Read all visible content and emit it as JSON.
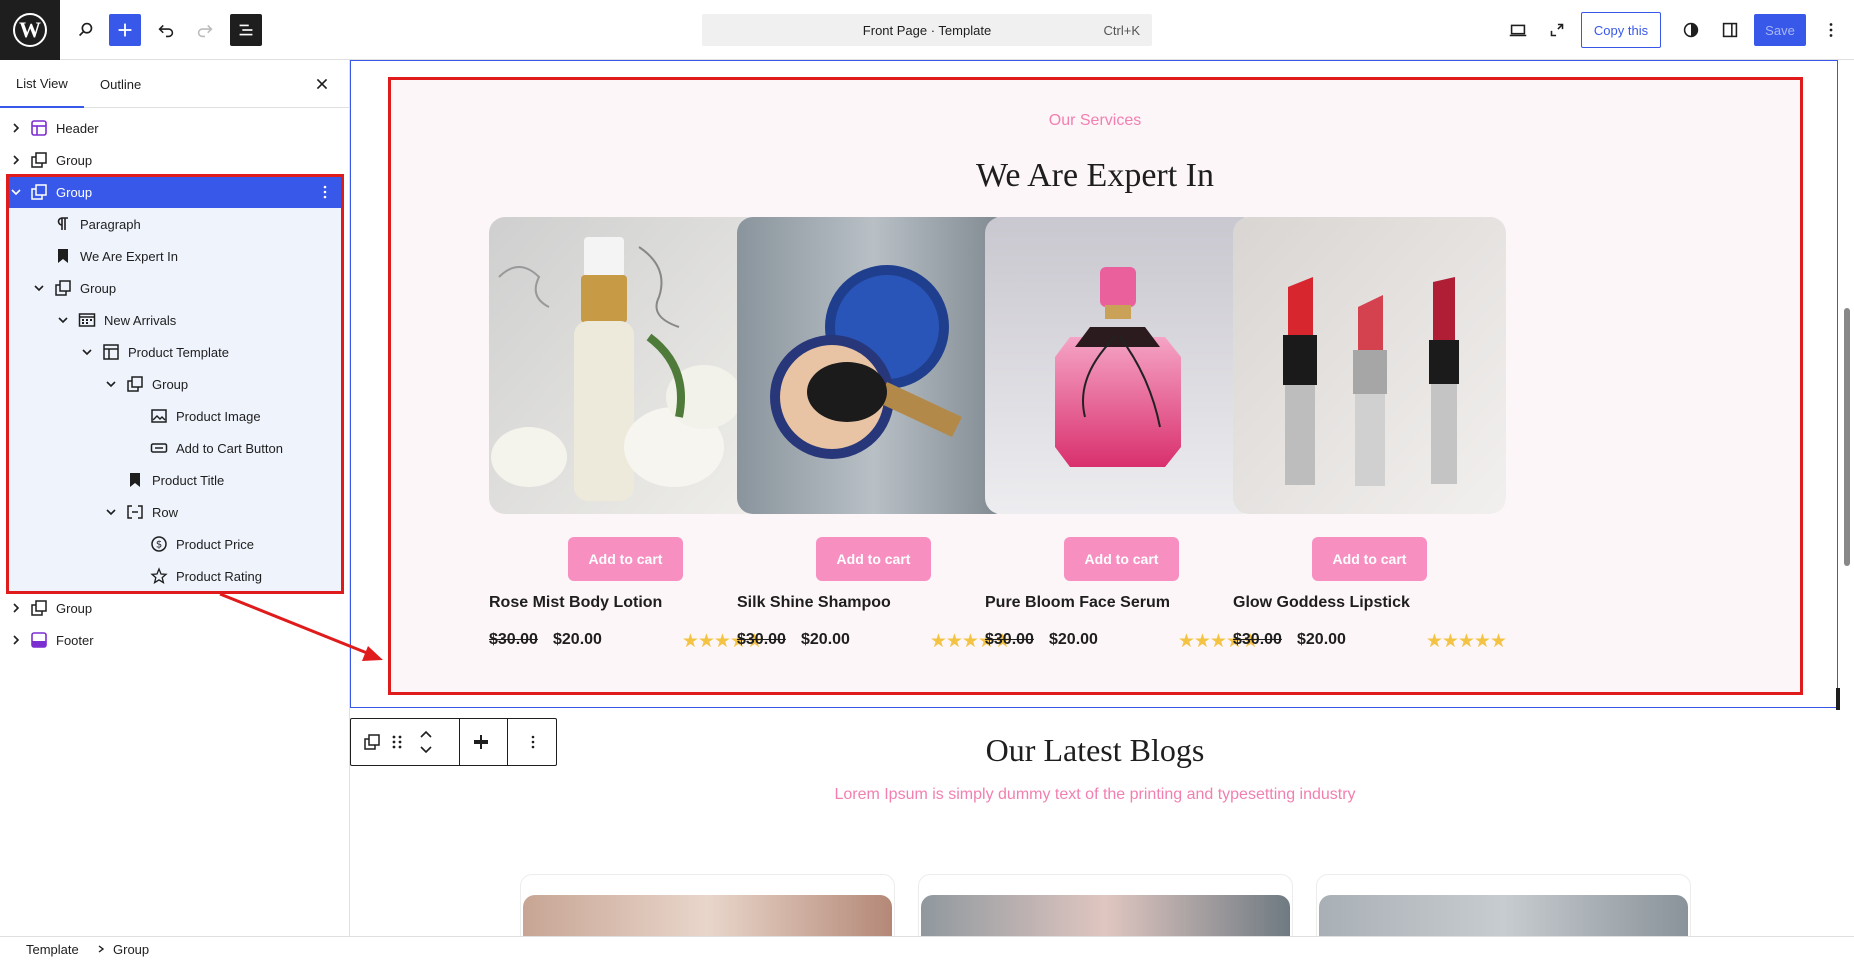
{
  "topbar": {
    "command_title": "Front Page · Template",
    "command_shortcut": "Ctrl+K",
    "copy_label": "Copy this",
    "save_label": "Save"
  },
  "sidebar": {
    "tab_list": "List View",
    "tab_outline": "Outline",
    "items": [
      {
        "label": "Header"
      },
      {
        "label": "Group"
      },
      {
        "label": "Group"
      },
      {
        "label": "Paragraph"
      },
      {
        "label": "We Are Expert In"
      },
      {
        "label": "Group"
      },
      {
        "label": "New Arrivals"
      },
      {
        "label": "Product Template"
      },
      {
        "label": "Group"
      },
      {
        "label": "Product Image"
      },
      {
        "label": "Add to Cart Button"
      },
      {
        "label": "Product Title"
      },
      {
        "label": "Row"
      },
      {
        "label": "Product Price"
      },
      {
        "label": "Product Rating"
      },
      {
        "label": "Group"
      },
      {
        "label": "Footer"
      }
    ]
  },
  "services": {
    "eyebrow": "Our Services",
    "heading": "We Are Expert In",
    "products": [
      {
        "title": "Rose Mist Body Lotion",
        "old_price": "$30.00",
        "price": "$20.00",
        "cart_label": "Add to cart",
        "rating": 5
      },
      {
        "title": "Silk Shine Shampoo",
        "old_price": "$30.00",
        "price": "$20.00",
        "cart_label": "Add to cart",
        "rating": 5
      },
      {
        "title": "Pure Bloom Face Serum",
        "old_price": "$30.00",
        "price": "$20.00",
        "cart_label": "Add to cart",
        "rating": 5
      },
      {
        "title": "Glow Goddess Lipstick",
        "old_price": "$30.00",
        "price": "$20.00",
        "cart_label": "Add to cart",
        "rating": 5
      }
    ]
  },
  "blogs": {
    "title": "Our Latest Blogs",
    "subtitle": "Lorem Ipsum is simply dummy text of the printing and typesetting industry"
  },
  "breadcrumb": {
    "root": "Template",
    "current": "Group"
  },
  "colors": {
    "accent": "#3858e9",
    "pink": "#f78fc1",
    "annotation": "#e01b1b",
    "star": "#f5c344"
  }
}
